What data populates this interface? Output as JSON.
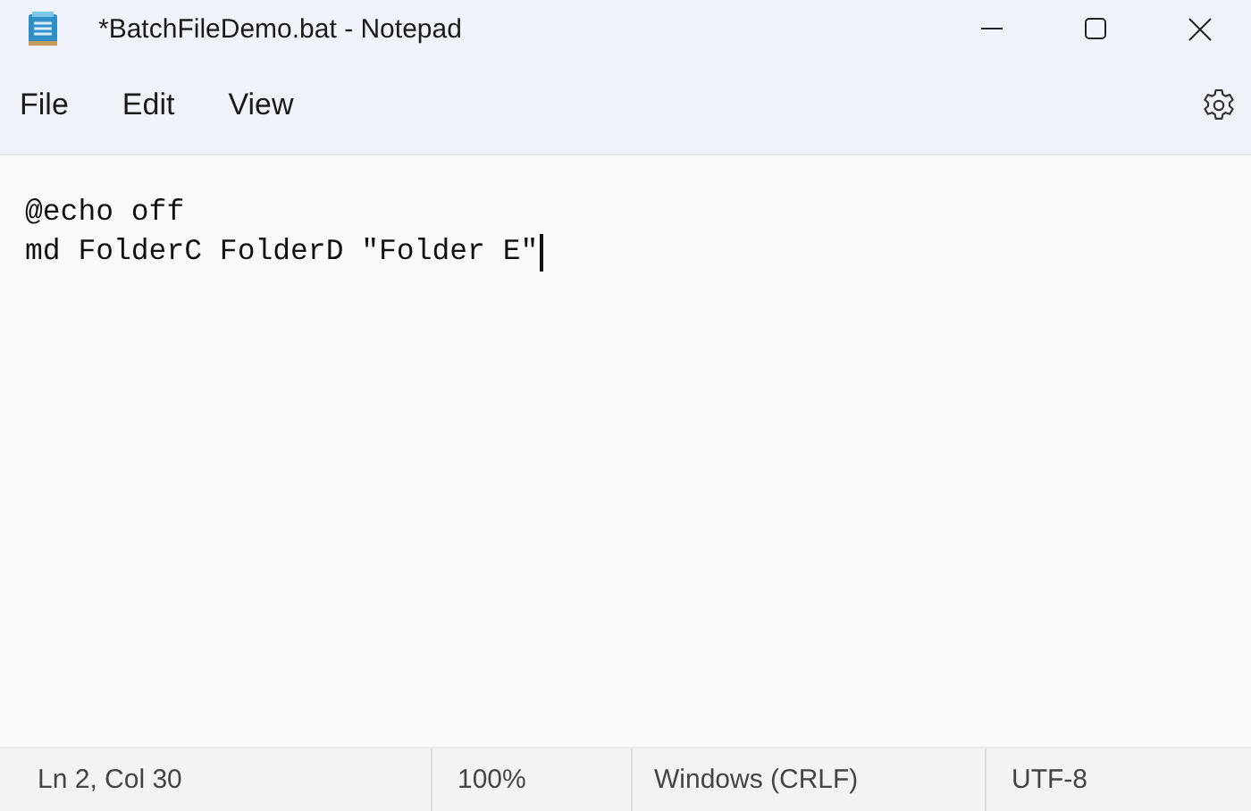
{
  "window": {
    "title": "*BatchFileDemo.bat - Notepad"
  },
  "menu": [
    "File",
    "Edit",
    "View"
  ],
  "editor": {
    "lines": [
      "@echo off",
      "md FolderC FolderD \"Folder E\""
    ]
  },
  "status_bar": [
    "Ln 2, Col 30",
    "100%",
    "Windows (CRLF)",
    "UTF-8"
  ]
}
